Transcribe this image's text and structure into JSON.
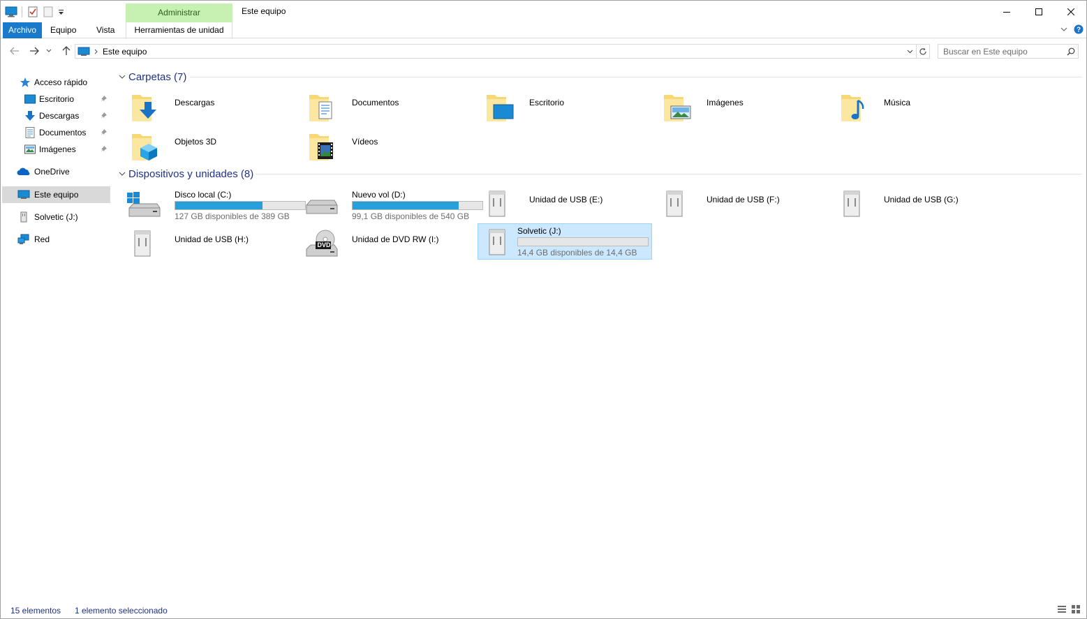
{
  "window": {
    "title": "Este equipo",
    "context_tab_group": "Administrar"
  },
  "ribbon": {
    "tabs": [
      "Archivo",
      "Equipo",
      "Vista",
      "Herramientas de unidad"
    ]
  },
  "navigation": {
    "address_path": "Este equipo",
    "search_placeholder": "Buscar en Este equipo"
  },
  "sidebar": {
    "quick_access": "Acceso rápido",
    "quick_items": [
      {
        "label": "Escritorio",
        "icon": "desktop-icon"
      },
      {
        "label": "Descargas",
        "icon": "download-icon"
      },
      {
        "label": "Documentos",
        "icon": "document-icon"
      },
      {
        "label": "Imágenes",
        "icon": "pictures-icon"
      }
    ],
    "onedrive": "OneDrive",
    "this_pc": "Este equipo",
    "usb_drive": "Solvetic (J:)",
    "network": "Red"
  },
  "folders": {
    "header": "Carpetas (7)",
    "items": [
      {
        "label": "Descargas",
        "icon": "downloads-folder-icon"
      },
      {
        "label": "Documentos",
        "icon": "documents-folder-icon"
      },
      {
        "label": "Escritorio",
        "icon": "desktop-folder-icon"
      },
      {
        "label": "Imágenes",
        "icon": "pictures-folder-icon"
      },
      {
        "label": "Música",
        "icon": "music-folder-icon"
      },
      {
        "label": "Objetos 3D",
        "icon": "3d-objects-folder-icon"
      },
      {
        "label": "Vídeos",
        "icon": "videos-folder-icon"
      }
    ]
  },
  "devices": {
    "header": "Dispositivos y unidades (8)",
    "items": [
      {
        "label": "Disco local (C:)",
        "free": "127 GB disponibles de 389 GB",
        "used_fraction": 0.674,
        "icon": "windows-drive-icon"
      },
      {
        "label": "Nuevo vol (D:)",
        "free": "99,1 GB disponibles de 540 GB",
        "used_fraction": 0.816,
        "icon": "hard-drive-icon"
      },
      {
        "label": "Unidad de USB (E:)",
        "icon": "usb-drive-icon"
      },
      {
        "label": "Unidad de USB (F:)",
        "icon": "usb-drive-icon"
      },
      {
        "label": "Unidad de USB (G:)",
        "icon": "usb-drive-icon"
      },
      {
        "label": "Unidad de USB (H:)",
        "icon": "usb-drive-icon"
      },
      {
        "label": "Unidad de DVD RW (I:)",
        "icon": "dvd-drive-icon",
        "badge": "DVD"
      },
      {
        "label": "Solvetic (J:)",
        "free": "14,4 GB disponibles de 14,4 GB",
        "used_fraction": 0.0,
        "icon": "usb-drive-icon",
        "selected": true
      }
    ]
  },
  "status": {
    "count": "15 elementos",
    "selection": "1 elemento seleccionado"
  },
  "colors": {
    "file_tab": "#1979ca",
    "context_tab": "#c7f0b3",
    "group_header": "#1e3287",
    "drive_bar": "#26a0da",
    "selection": "#cce8ff"
  }
}
